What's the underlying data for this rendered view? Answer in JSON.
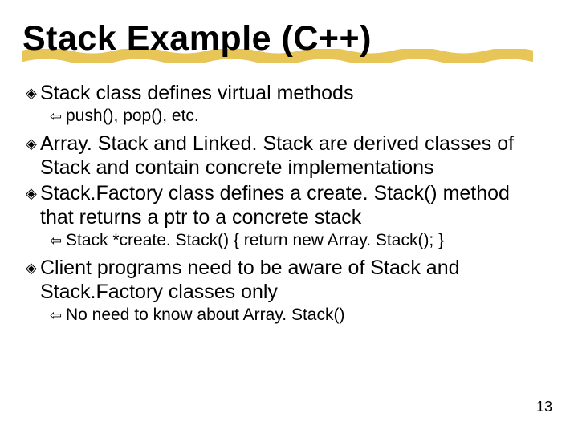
{
  "title": "Stack Example (C++)",
  "bullets": {
    "b0": {
      "text": "Stack class defines virtual methods"
    },
    "b0s0": {
      "text": "push(), pop(), etc."
    },
    "b1": {
      "text": "Array. Stack and Linked. Stack are derived classes of Stack and contain concrete implementations"
    },
    "b2": {
      "text": "Stack.Factory class defines a create. Stack() method that returns a ptr to a concrete stack"
    },
    "b2s0": {
      "text": "Stack *create. Stack() { return new Array. Stack(); }"
    },
    "b3": {
      "text": "Client programs need to be aware of Stack and Stack.Factory classes only"
    },
    "b3s0": {
      "text": "No need to know about Array. Stack()"
    }
  },
  "glyphs": {
    "level1": "◈",
    "level2": "⇦"
  },
  "colors": {
    "underline": "#e8c557"
  },
  "page_number": "13"
}
